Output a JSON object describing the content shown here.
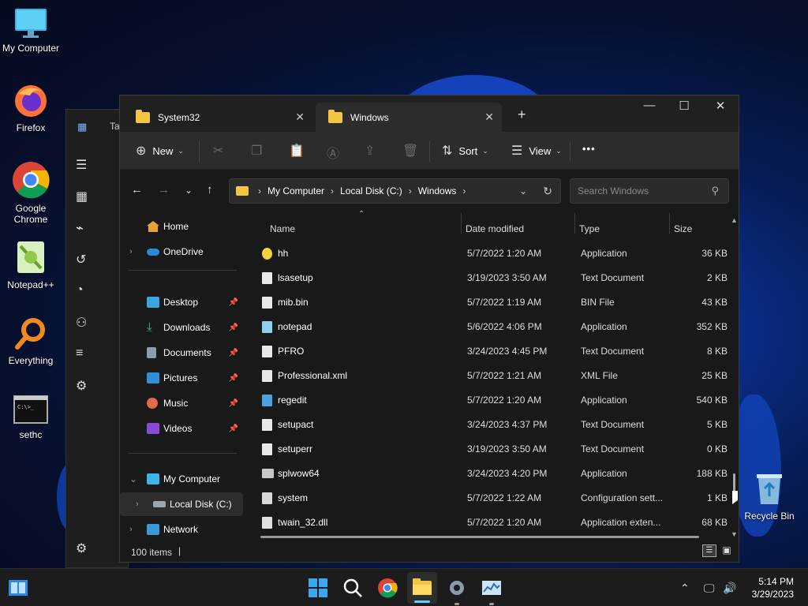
{
  "desktop": {
    "icons": [
      {
        "label": "My Computer",
        "icon": "monitor-icon"
      },
      {
        "label": "Firefox",
        "icon": "firefox-icon"
      },
      {
        "label": "Google Chrome",
        "icon": "chrome-icon"
      },
      {
        "label": "Notepad++",
        "icon": "notepadpp-icon"
      },
      {
        "label": "Everything",
        "icon": "everything-icon"
      },
      {
        "label": "sethc",
        "icon": "console-icon"
      },
      {
        "label": "Recycle Bin",
        "icon": "recycle-bin-icon"
      }
    ]
  },
  "bgwindow": {
    "title_partial": "Ta"
  },
  "explorer": {
    "tabs": [
      {
        "label": "System32",
        "active": false
      },
      {
        "label": "Windows",
        "active": true
      }
    ],
    "toolbar": {
      "new_label": "New",
      "sort_label": "Sort",
      "view_label": "View",
      "more": "•••"
    },
    "address": {
      "crumbs": [
        "My Computer",
        "Local Disk (C:)",
        "Windows"
      ]
    },
    "search": {
      "placeholder": "Search Windows"
    },
    "nav": {
      "home": "Home",
      "onedrive": "OneDrive",
      "desktop": "Desktop",
      "downloads": "Downloads",
      "documents": "Documents",
      "pictures": "Pictures",
      "music": "Music",
      "videos": "Videos",
      "mycomputer": "My Computer",
      "localdisk": "Local Disk (C:)",
      "network": "Network"
    },
    "columns": {
      "name": "Name",
      "date": "Date modified",
      "type": "Type",
      "size": "Size"
    },
    "files": [
      {
        "name": "hh",
        "date": "5/7/2022 1:20 AM",
        "type": "Application",
        "size": "36 KB",
        "icon": "help-app-icon"
      },
      {
        "name": "lsasetup",
        "date": "3/19/2023 3:50 AM",
        "type": "Text Document",
        "size": "2 KB",
        "icon": "text-file-icon"
      },
      {
        "name": "mib.bin",
        "date": "5/7/2022 1:19 AM",
        "type": "BIN File",
        "size": "43 KB",
        "icon": "file-icon"
      },
      {
        "name": "notepad",
        "date": "5/6/2022 4:06 PM",
        "type": "Application",
        "size": "352 KB",
        "icon": "notepad-app-icon"
      },
      {
        "name": "PFRO",
        "date": "3/24/2023 4:45 PM",
        "type": "Text Document",
        "size": "8 KB",
        "icon": "text-file-icon"
      },
      {
        "name": "Professional.xml",
        "date": "5/7/2022 1:21 AM",
        "type": "XML File",
        "size": "25 KB",
        "icon": "file-icon"
      },
      {
        "name": "regedit",
        "date": "5/7/2022 1:20 AM",
        "type": "Application",
        "size": "540 KB",
        "icon": "regedit-app-icon"
      },
      {
        "name": "setupact",
        "date": "3/24/2023 4:37 PM",
        "type": "Text Document",
        "size": "5 KB",
        "icon": "text-file-icon"
      },
      {
        "name": "setuperr",
        "date": "3/19/2023 3:50 AM",
        "type": "Text Document",
        "size": "0 KB",
        "icon": "text-file-icon"
      },
      {
        "name": "splwow64",
        "date": "3/24/2023 4:20 PM",
        "type": "Application",
        "size": "188 KB",
        "icon": "printer-app-icon"
      },
      {
        "name": "system",
        "date": "5/7/2022 1:22 AM",
        "type": "Configuration sett...",
        "size": "1 KB",
        "icon": "config-file-icon"
      },
      {
        "name": "twain_32.dll",
        "date": "5/7/2022 1:20 AM",
        "type": "Application exten...",
        "size": "68 KB",
        "icon": "dll-file-icon"
      }
    ],
    "status": {
      "count": "100 items"
    }
  },
  "taskbar": {
    "time": "5:14 PM",
    "date": "3/29/2023"
  },
  "colors": {
    "accent": "#0078d4",
    "folder": "#f4c443"
  }
}
